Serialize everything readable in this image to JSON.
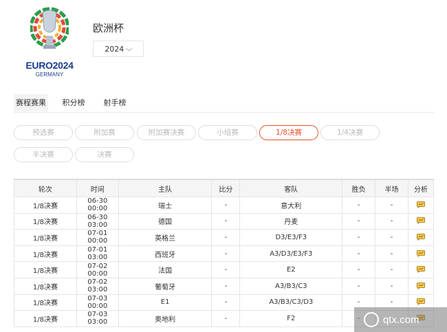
{
  "header": {
    "logo": {
      "brand": "EURO2024",
      "sub": "GERMANY",
      "small": "UEFA"
    },
    "title": "欧洲杯",
    "year_select": {
      "value": "2024"
    }
  },
  "tabs": [
    {
      "label": "赛程赛果",
      "active": true
    },
    {
      "label": "积分榜",
      "active": false
    },
    {
      "label": "射手榜",
      "active": false
    }
  ],
  "stages": [
    {
      "label": "预选赛",
      "active": false
    },
    {
      "label": "附加赛",
      "active": false
    },
    {
      "label": "附加赛决赛",
      "active": false
    },
    {
      "label": "小组赛",
      "active": false
    },
    {
      "label": "1/8决赛",
      "active": true
    },
    {
      "label": "1/4决赛",
      "active": false
    },
    {
      "label": "半决赛",
      "active": false
    },
    {
      "label": "决赛",
      "active": false
    }
  ],
  "table": {
    "headers": [
      "轮次",
      "时间",
      "主队",
      "比分",
      "客队",
      "胜负",
      "半场",
      "分析"
    ],
    "rows": [
      [
        "1/8决赛",
        "06-30 00:00",
        "瑞士",
        "-",
        "意大利",
        "-",
        "-"
      ],
      [
        "1/8决赛",
        "06-30 03:00",
        "德国",
        "-",
        "丹麦",
        "-",
        "-"
      ],
      [
        "1/8决赛",
        "07-01 00:00",
        "英格兰",
        "-",
        "D3/E3/F3",
        "-",
        "-"
      ],
      [
        "1/8决赛",
        "07-01 03:00",
        "西班牙",
        "-",
        "A3/D3/E3/F3",
        "-",
        "-"
      ],
      [
        "1/8决赛",
        "07-02 00:00",
        "法国",
        "-",
        "E2",
        "-",
        "-"
      ],
      [
        "1/8决赛",
        "07-02 03:00",
        "葡萄牙",
        "-",
        "A3/B3/C3",
        "-",
        "-"
      ],
      [
        "1/8决赛",
        "07-03 00:00",
        "E1",
        "-",
        "A3/B3/C3/D3",
        "-",
        "-"
      ],
      [
        "1/8决赛",
        "07-03 03:00",
        "奥地利",
        "-",
        "F2",
        "-",
        "-"
      ]
    ]
  },
  "watermark": {
    "text": "qtx.com"
  },
  "colors": {
    "accent": "#e8522b",
    "brand_blue": "#1b3d8f"
  }
}
